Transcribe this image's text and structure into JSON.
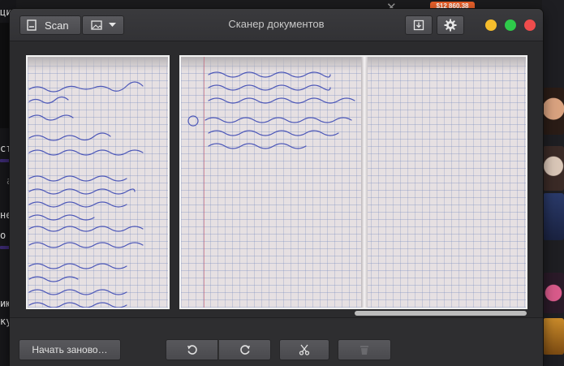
{
  "window": {
    "title": "Сканер документов",
    "toolbar": {
      "scan_label": "Scan"
    },
    "traffic_lights": {
      "minimize": "#f5bd2c",
      "maximize": "#2ec94a",
      "close": "#ef4c4c"
    }
  },
  "bottom": {
    "restart_label": "Начать заново…"
  },
  "background": {
    "left_fragments": [
      "ци",
      "сто",
      "а",
      "не",
      "о",
      "ию",
      "ку"
    ],
    "right_pill": "$12 860.38"
  },
  "icons": {
    "scan": "document-icon",
    "image": "image-icon",
    "export": "download-tray-icon",
    "settings": "gear-icon",
    "rotate_left": "rotate-ccw-icon",
    "rotate_right": "rotate-cw-icon",
    "crop": "scissors-icon",
    "delete": "trash-icon"
  }
}
